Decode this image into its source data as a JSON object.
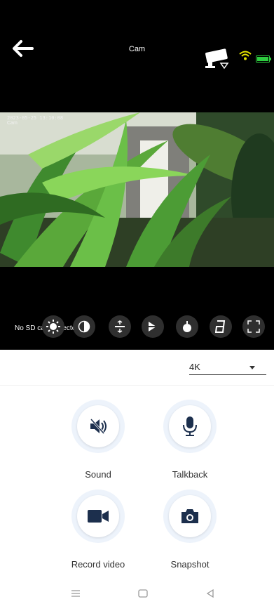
{
  "header": {
    "title": "Cam",
    "back_icon": "back-arrow-icon",
    "camera_icon": "camera-status-icon",
    "wifi_icon": "wifi-icon",
    "battery_icon": "battery-icon",
    "colors": {
      "wifi": "#e6e600",
      "battery": "#2ecc40"
    }
  },
  "video": {
    "timestamp": "2023-05-25 13:10:08",
    "channel_label": "Cam"
  },
  "controls": {
    "sd_status": "No SD card detected",
    "buttons": [
      {
        "name": "brightness-icon"
      },
      {
        "name": "contrast-icon"
      },
      {
        "name": "flip-vertical-icon"
      },
      {
        "name": "flip-horizontal-icon"
      },
      {
        "name": "night-mode-icon"
      },
      {
        "name": "digit-display-icon"
      },
      {
        "name": "fullscreen-icon"
      }
    ]
  },
  "quality": {
    "selected": "4K"
  },
  "actions": {
    "sound": {
      "label": "Sound",
      "icon": "speaker-muted-icon"
    },
    "talkback": {
      "label": "Talkback",
      "icon": "microphone-icon"
    },
    "record": {
      "label": "Record video",
      "icon": "video-camera-icon"
    },
    "snapshot": {
      "label": "Snapshot",
      "icon": "camera-icon"
    }
  },
  "system_nav": {
    "menu": "menu-icon",
    "home": "home-icon",
    "back": "back-triangle-icon"
  }
}
